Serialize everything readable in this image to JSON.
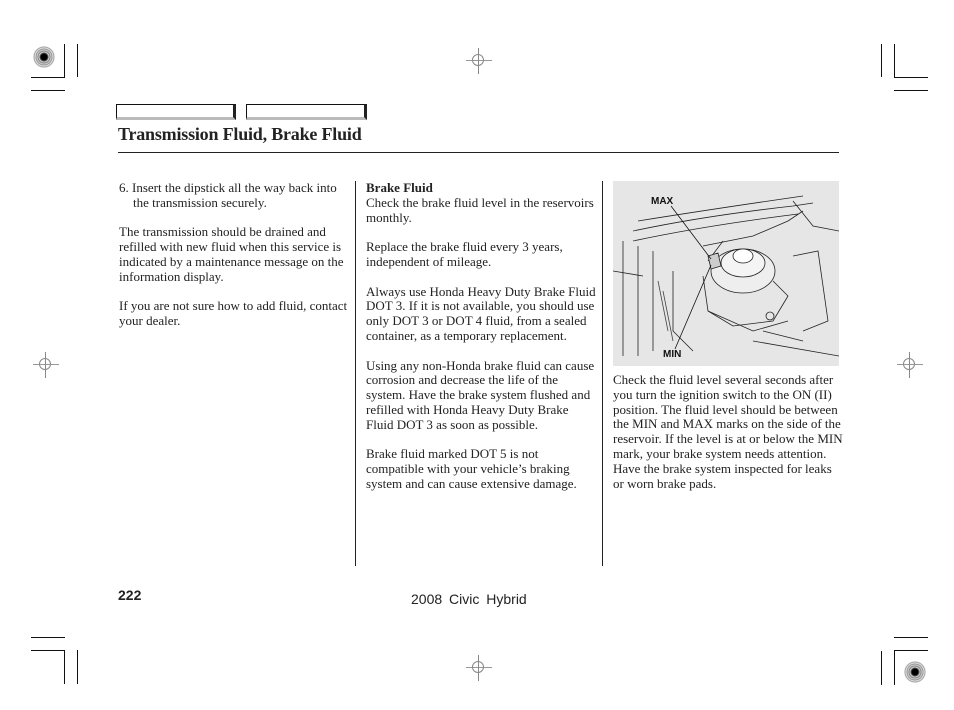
{
  "header": {
    "title": "Transmission Fluid, Brake Fluid"
  },
  "left_column": {
    "step": "6. Insert the dipstick all the way back into the transmission securely.",
    "para1": "The transmission should be drained and refilled with new fluid when this service is indicated by a maintenance message on the information display.",
    "para2": "If you are not sure how to add fluid, contact your dealer."
  },
  "middle_column": {
    "heading": "Brake Fluid",
    "para1": "Check the brake fluid level in the reservoirs monthly.",
    "para2": "Replace the brake fluid every 3 years, independent of mileage.",
    "para3": "Always use Honda Heavy Duty Brake Fluid DOT 3. If it is not available, you should use only DOT 3 or DOT 4 fluid, from a sealed container, as a temporary replacement.",
    "para4": "Using any non-Honda brake fluid can cause corrosion and decrease the life of the system. Have the brake system flushed and refilled with Honda Heavy Duty Brake Fluid DOT 3 as soon as possible.",
    "para5": "Brake fluid marked DOT 5 is not compatible with your vehicle’s braking system and can cause extensive damage."
  },
  "right_column": {
    "figure": {
      "label_max": "MAX",
      "label_min": "MIN",
      "description": "brake fluid reservoir illustration"
    },
    "para1": "Check the fluid level several seconds after you turn the ignition switch to the ON (II) position. The fluid level should be between the MIN and MAX marks on the side of the reservoir. If the level is at or below the MIN mark, your brake system needs attention. Have the brake system inspected for leaks or worn brake pads."
  },
  "footer": {
    "page_number": "222",
    "model": "2008  Civic  Hybrid"
  }
}
